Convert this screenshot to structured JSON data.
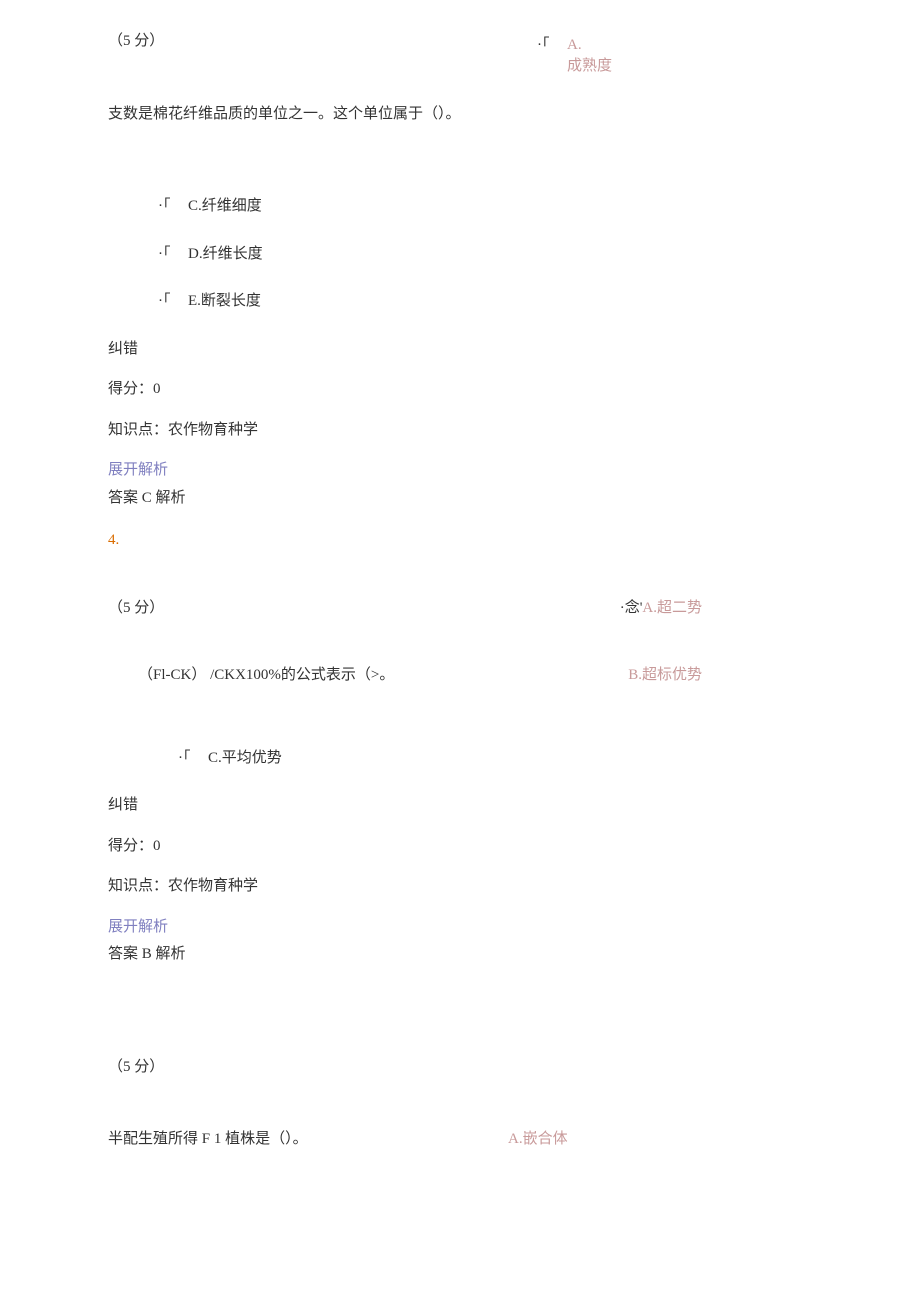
{
  "q3": {
    "points": "（5 分）",
    "annotation_a_prefix": "·「",
    "annotation_a": "A.",
    "annotation_a_line2": "成熟度",
    "question": "支数是棉花纤维品质的单位之一。这个单位属于（）。",
    "options": {
      "c": "C.纤维细度",
      "d": "D.纤维长度",
      "e": "E.断裂长度"
    },
    "correction": "纠错",
    "score": "得分：0",
    "knowledge": "知识点：农作物育种学",
    "expand": "展开解析",
    "answer": "答案 C 解析"
  },
  "q4": {
    "number": "4.",
    "points": "（5 分）",
    "points_right_prefix": "·念'",
    "points_right_option": "A.超二势",
    "formula": "（Fl-CK） /CKX100%的公式表示（>。",
    "formula_right": "B.超标优势",
    "option_c": "C.平均优势",
    "correction": "纠错",
    "score": "得分：0",
    "knowledge": "知识点：农作物育种学",
    "expand": "展开解析",
    "answer": "答案 B 解析"
  },
  "q5": {
    "points": "（5 分）",
    "question": "半配生殖所得 F 1 植株是（）。",
    "right_a": "A.嵌合体"
  }
}
